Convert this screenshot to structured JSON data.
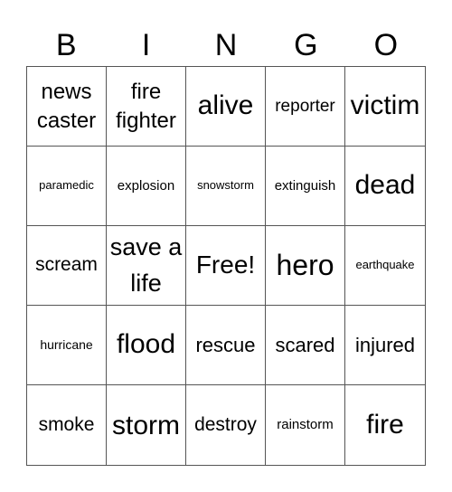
{
  "header": {
    "letters": [
      "B",
      "I",
      "N",
      "G",
      "O"
    ]
  },
  "cells": [
    {
      "text": "news caster",
      "size": "s4"
    },
    {
      "text": "fire fighter",
      "size": "s4"
    },
    {
      "text": "alive",
      "size": "s5"
    },
    {
      "text": "reporter",
      "size": "s3"
    },
    {
      "text": "victim",
      "size": "s5"
    },
    {
      "text": "paramedic",
      "size": "s1"
    },
    {
      "text": "explosion",
      "size": "s2"
    },
    {
      "text": "snowstorm",
      "size": "s1"
    },
    {
      "text": "extinguish",
      "size": "s2"
    },
    {
      "text": "dead",
      "size": "s5"
    },
    {
      "text": "scream",
      "size": "s3"
    },
    {
      "text": "save a life",
      "size": "s5"
    },
    {
      "text": "Free!",
      "size": "s5"
    },
    {
      "text": "hero",
      "size": "s5"
    },
    {
      "text": "earthquake",
      "size": "s1"
    },
    {
      "text": "hurricane",
      "size": "s2"
    },
    {
      "text": "flood",
      "size": "s5"
    },
    {
      "text": "rescue",
      "size": "s3"
    },
    {
      "text": "scared",
      "size": "s3"
    },
    {
      "text": "injured",
      "size": "s3"
    },
    {
      "text": "smoke",
      "size": "s3"
    },
    {
      "text": "storm",
      "size": "s4"
    },
    {
      "text": "destroy",
      "size": "s3"
    },
    {
      "text": "rainstorm",
      "size": "s2"
    },
    {
      "text": "fire",
      "size": "s5"
    }
  ]
}
